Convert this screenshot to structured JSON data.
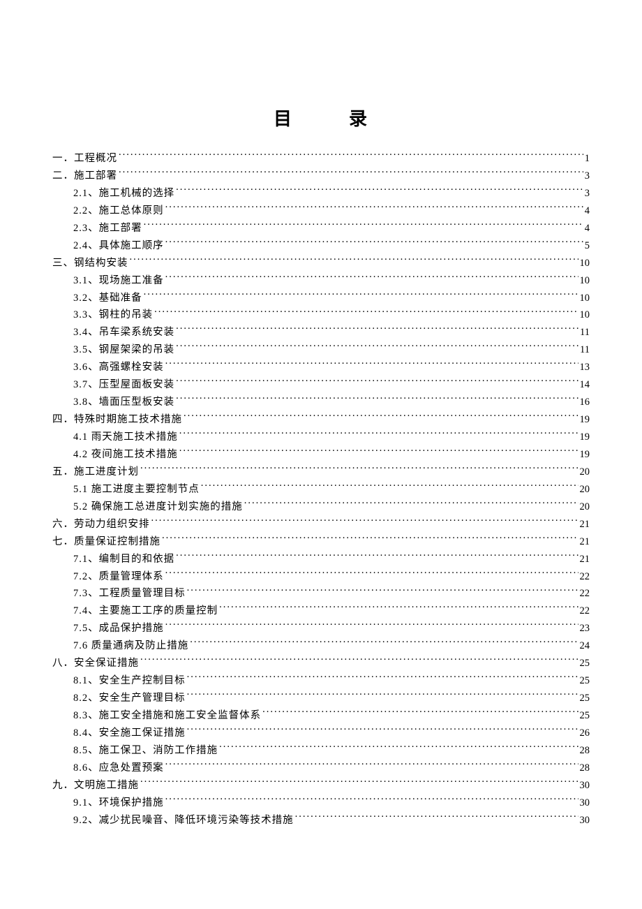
{
  "title_left": "目",
  "title_right": "录",
  "toc": [
    {
      "level": 1,
      "label": "一．工程概况",
      "page": "1"
    },
    {
      "level": 1,
      "label": "二．施工部署",
      "page": "3"
    },
    {
      "level": 2,
      "label": "2.1、施工机械的选择",
      "page": "3"
    },
    {
      "level": 2,
      "label": "2.2、施工总体原则",
      "page": "4"
    },
    {
      "level": 2,
      "label": "2.3、施工部署",
      "page": "4"
    },
    {
      "level": 2,
      "label": "2.4、具体施工顺序",
      "page": "5"
    },
    {
      "level": 1,
      "label": "三、钢结构安装",
      "page": "10"
    },
    {
      "level": 2,
      "label": "3.1、现场施工准备",
      "page": "10"
    },
    {
      "level": 2,
      "label": "3.2、基础准备",
      "page": "10"
    },
    {
      "level": 2,
      "label": "3.3、钢柱的吊装",
      "page": "10"
    },
    {
      "level": 2,
      "label": "3.4、吊车梁系统安装",
      "page": "11"
    },
    {
      "level": 2,
      "label": "3.5、钢屋架梁的吊装",
      "page": "11"
    },
    {
      "level": 2,
      "label": "3.6、高强螺栓安装",
      "page": "13"
    },
    {
      "level": 2,
      "label": "3.7、压型屋面板安装",
      "page": "14"
    },
    {
      "level": 2,
      "label": "3.8、墙面压型板安装",
      "page": "16"
    },
    {
      "level": 1,
      "label": "四．特殊时期施工技术措施",
      "page": "19"
    },
    {
      "level": 2,
      "label": "4.1 雨天施工技术措施 ",
      "page": "19"
    },
    {
      "level": 2,
      "label": "4.2 夜间施工技术措施 ",
      "page": "19"
    },
    {
      "level": 1,
      "label": "五．施工进度计划",
      "page": "20"
    },
    {
      "level": 2,
      "label": "5.1 施工进度主要控制节点 ",
      "page": "20"
    },
    {
      "level": 2,
      "label": "5.2 确保施工总进度计划实施的措施 ",
      "page": "20"
    },
    {
      "level": 1,
      "label": "六．劳动力组织安排",
      "page": "21"
    },
    {
      "level": 1,
      "label": "七．质量保证控制措施",
      "page": "21"
    },
    {
      "level": 2,
      "label": "7.1、编制目的和依据",
      "page": "21"
    },
    {
      "level": 2,
      "label": "7.2、质量管理体系",
      "page": "22"
    },
    {
      "level": 2,
      "label": "7.3、工程质量管理目标",
      "page": "22"
    },
    {
      "level": 2,
      "label": "7.4、主要施工工序的质量控制",
      "page": "22"
    },
    {
      "level": 2,
      "label": "7.5、成品保护措施",
      "page": "23"
    },
    {
      "level": 2,
      "label": "7.6 质量通病及防止措施 ",
      "page": "24"
    },
    {
      "level": 1,
      "label": "八．安全保证措施",
      "page": "25"
    },
    {
      "level": 2,
      "label": "8.1、安全生产控制目标",
      "page": "25"
    },
    {
      "level": 2,
      "label": "8.2、安全生产管理目标",
      "page": "25"
    },
    {
      "level": 2,
      "label": "8.3、施工安全措施和施工安全监督体系",
      "page": "25"
    },
    {
      "level": 2,
      "label": "8.4、安全施工保证措施",
      "page": "26"
    },
    {
      "level": 2,
      "label": "8.5、施工保卫、消防工作措施",
      "page": "28"
    },
    {
      "level": 2,
      "label": "8.6、应急处置预案",
      "page": "28"
    },
    {
      "level": 1,
      "label": "九．文明施工措施",
      "page": "30"
    },
    {
      "level": 2,
      "label": "9.1、环境保护措施",
      "page": "30"
    },
    {
      "level": 2,
      "label": "9.2、减少扰民噪音、降低环境污染等技术措施",
      "page": "30"
    }
  ]
}
